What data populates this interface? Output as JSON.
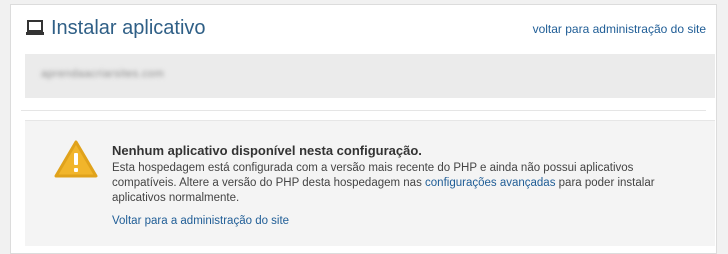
{
  "header": {
    "title": "Instalar aplicativo",
    "icon": "laptop-icon",
    "back_link": "voltar para administração do site"
  },
  "domain": {
    "text": "aprendaacriarsites.com"
  },
  "alert": {
    "icon": "warning-icon",
    "title": "Nenhum aplicativo disponível nesta configuração.",
    "body_part1": "Esta hospedagem está configurada com a versão mais recente do PHP e ainda não possui aplicativos compatíveis. Altere a versão do PHP desta hospedagem nas ",
    "link_text": "configurações avançadas",
    "body_part2": " para poder instalar aplicativos normalmente.",
    "back_link": "Voltar para a administração do site"
  },
  "colors": {
    "title": "#2f5f86",
    "link": "#1f5d96",
    "warning": "#f1b52b"
  }
}
